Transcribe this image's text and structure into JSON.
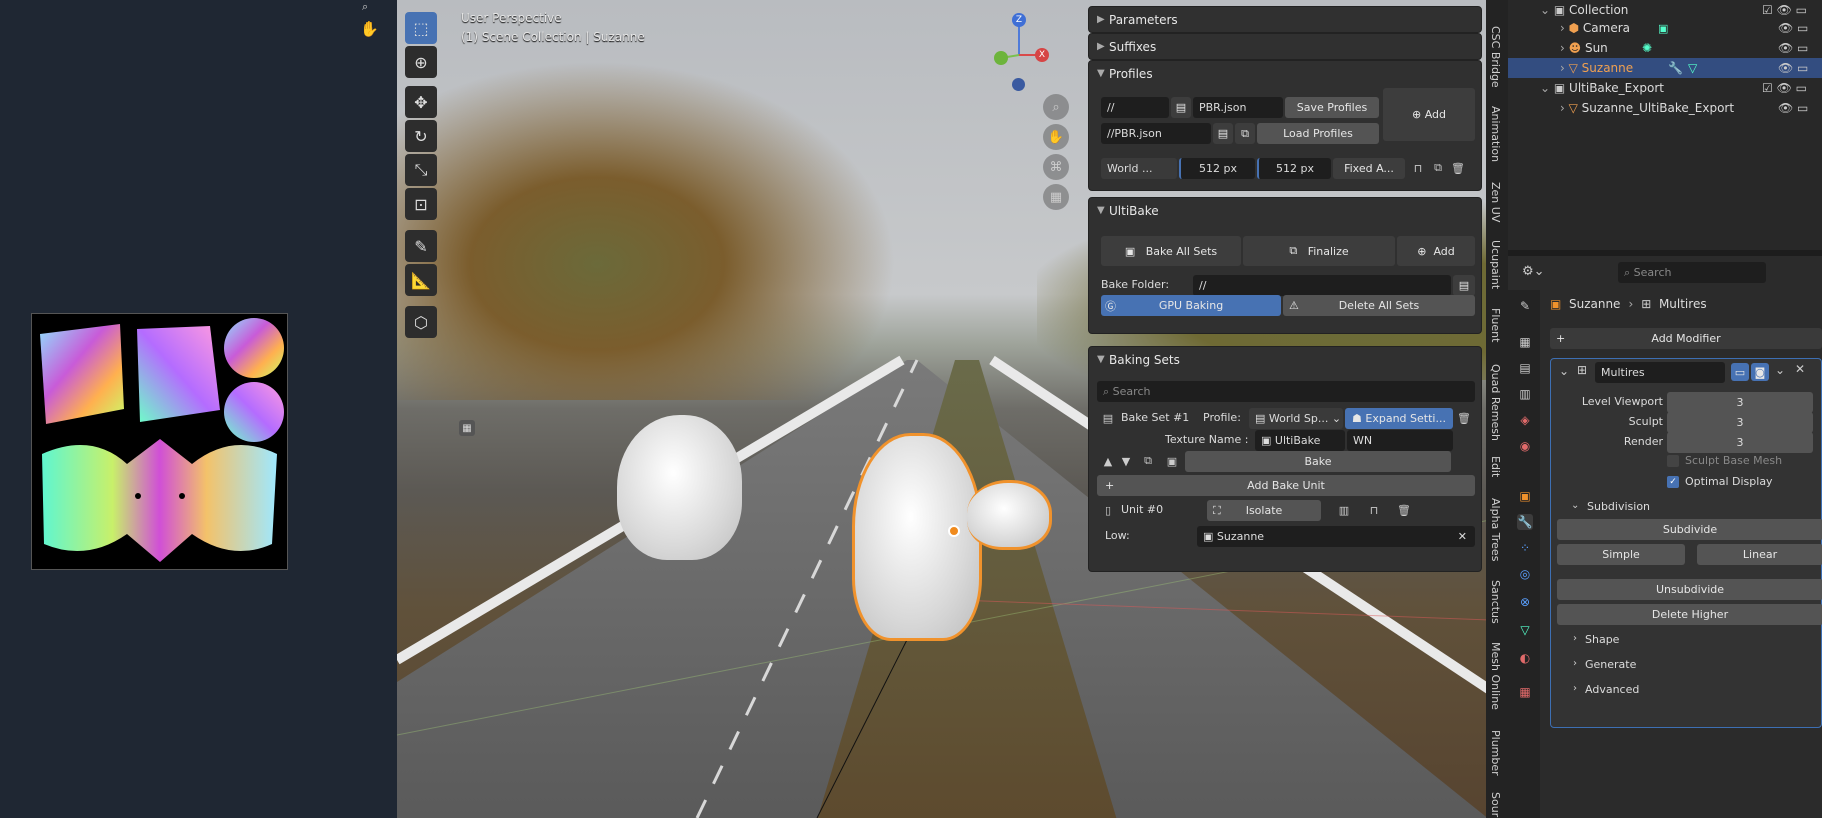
{
  "viewport": {
    "title": "User Perspective",
    "subtitle": "(1) Scene Collection | Suzanne",
    "gizmo": {
      "z": "Z",
      "x": "X"
    }
  },
  "panels": {
    "parameters": "Parameters",
    "suffixes": "Suffixes",
    "profiles": {
      "title": "Profiles",
      "path1": "//",
      "file1": "PBR.json",
      "save": "Save Profiles",
      "add": "Add",
      "path2": "//PBR.json",
      "load": "Load Profiles",
      "world": "World ...",
      "res1": "512 px",
      "res2": "512 px",
      "fixed": "Fixed A..."
    },
    "ultibake": {
      "title": "UltiBake",
      "bake_all": "Bake All Sets",
      "finalize": "Finalize",
      "add": "Add",
      "folder_label": "Bake Folder:",
      "folder_value": "//",
      "gpu": "GPU Baking",
      "delete_all": "Delete All Sets"
    },
    "baking_sets": {
      "title": "Baking Sets",
      "search_placeholder": "Search",
      "set_name": "Bake Set #1",
      "profile_label": "Profile:",
      "profile_value": "World Sp...",
      "expand": "Expand Setti...",
      "texture_label": "Texture Name :",
      "texture_value": "UltiBake",
      "texture_suffix": "WN",
      "bake": "Bake",
      "add_unit": "Add Bake Unit",
      "unit": "Unit #0",
      "isolate": "Isolate",
      "low_label": "Low:",
      "low_value": "Suzanne"
    }
  },
  "side_tabs": [
    "CSC Bridge",
    "Animation",
    "Zen UV",
    "Ucupaint",
    "Fluent",
    "Quad Remesh",
    "Edit",
    "Alpha Trees",
    "Sanctus",
    "Mesh Online",
    "Plumber",
    "Sour"
  ],
  "outliner": {
    "rows": [
      {
        "label": "Collection"
      },
      {
        "label": "Camera"
      },
      {
        "label": "Sun"
      },
      {
        "label": "Suzanne"
      },
      {
        "label": "UltiBake_Export"
      },
      {
        "label": "Suzanne_UltiBake_Export"
      }
    ]
  },
  "properties": {
    "search_placeholder": "Search",
    "breadcrumb_object": "Suzanne",
    "breadcrumb_modifier": "Multires",
    "add_modifier": "Add Modifier",
    "modifier_name": "Multires",
    "level_viewport_label": "Level Viewport",
    "level_viewport_value": "3",
    "sculpt_label": "Sculpt",
    "sculpt_value": "3",
    "render_label": "Render",
    "render_value": "3",
    "sculpt_base_mesh": "Sculpt Base Mesh",
    "optimal_display": "Optimal Display",
    "subdivision": "Subdivision",
    "subdivide": "Subdivide",
    "simple": "Simple",
    "linear": "Linear",
    "unsubdivide": "Unsubdivide",
    "delete_higher": "Delete Higher",
    "shape": "Shape",
    "generate": "Generate",
    "advanced": "Advanced"
  },
  "colors": {
    "accent": "#4772b3",
    "selection_outline": "#f0922c",
    "panel": "#303030"
  }
}
